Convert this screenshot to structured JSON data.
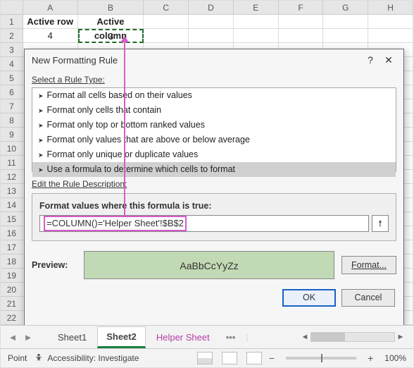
{
  "grid": {
    "cols": [
      "A",
      "B",
      "C",
      "D",
      "E",
      "F",
      "G",
      "H"
    ],
    "row1": {
      "A": "Active row",
      "B": "Active column"
    },
    "row2": {
      "A": "4",
      "B": "3"
    }
  },
  "dialog": {
    "title": "New Formatting Rule",
    "select_label": "Select a Rule Type:",
    "rules": [
      "Format all cells based on their values",
      "Format only cells that contain",
      "Format only top or bottom ranked values",
      "Format only values that are above or below average",
      "Format only unique or duplicate values",
      "Use a formula to determine which cells to format"
    ],
    "desc_label": "Edit the Rule Description:",
    "formula_label": "Format values where this formula is true:",
    "formula_value": "=COLUMN()='Helper Sheet'!$B$2",
    "preview_label": "Preview:",
    "preview_text": "AaBbCcYyZz",
    "format_btn": "Format...",
    "ok": "OK",
    "cancel": "Cancel"
  },
  "tabs": {
    "items": [
      "Sheet1",
      "Sheet2",
      "Helper Sheet"
    ],
    "more": "•••"
  },
  "status": {
    "mode": "Point",
    "access": "Accessibility: Investigate",
    "zoom": "100%"
  }
}
